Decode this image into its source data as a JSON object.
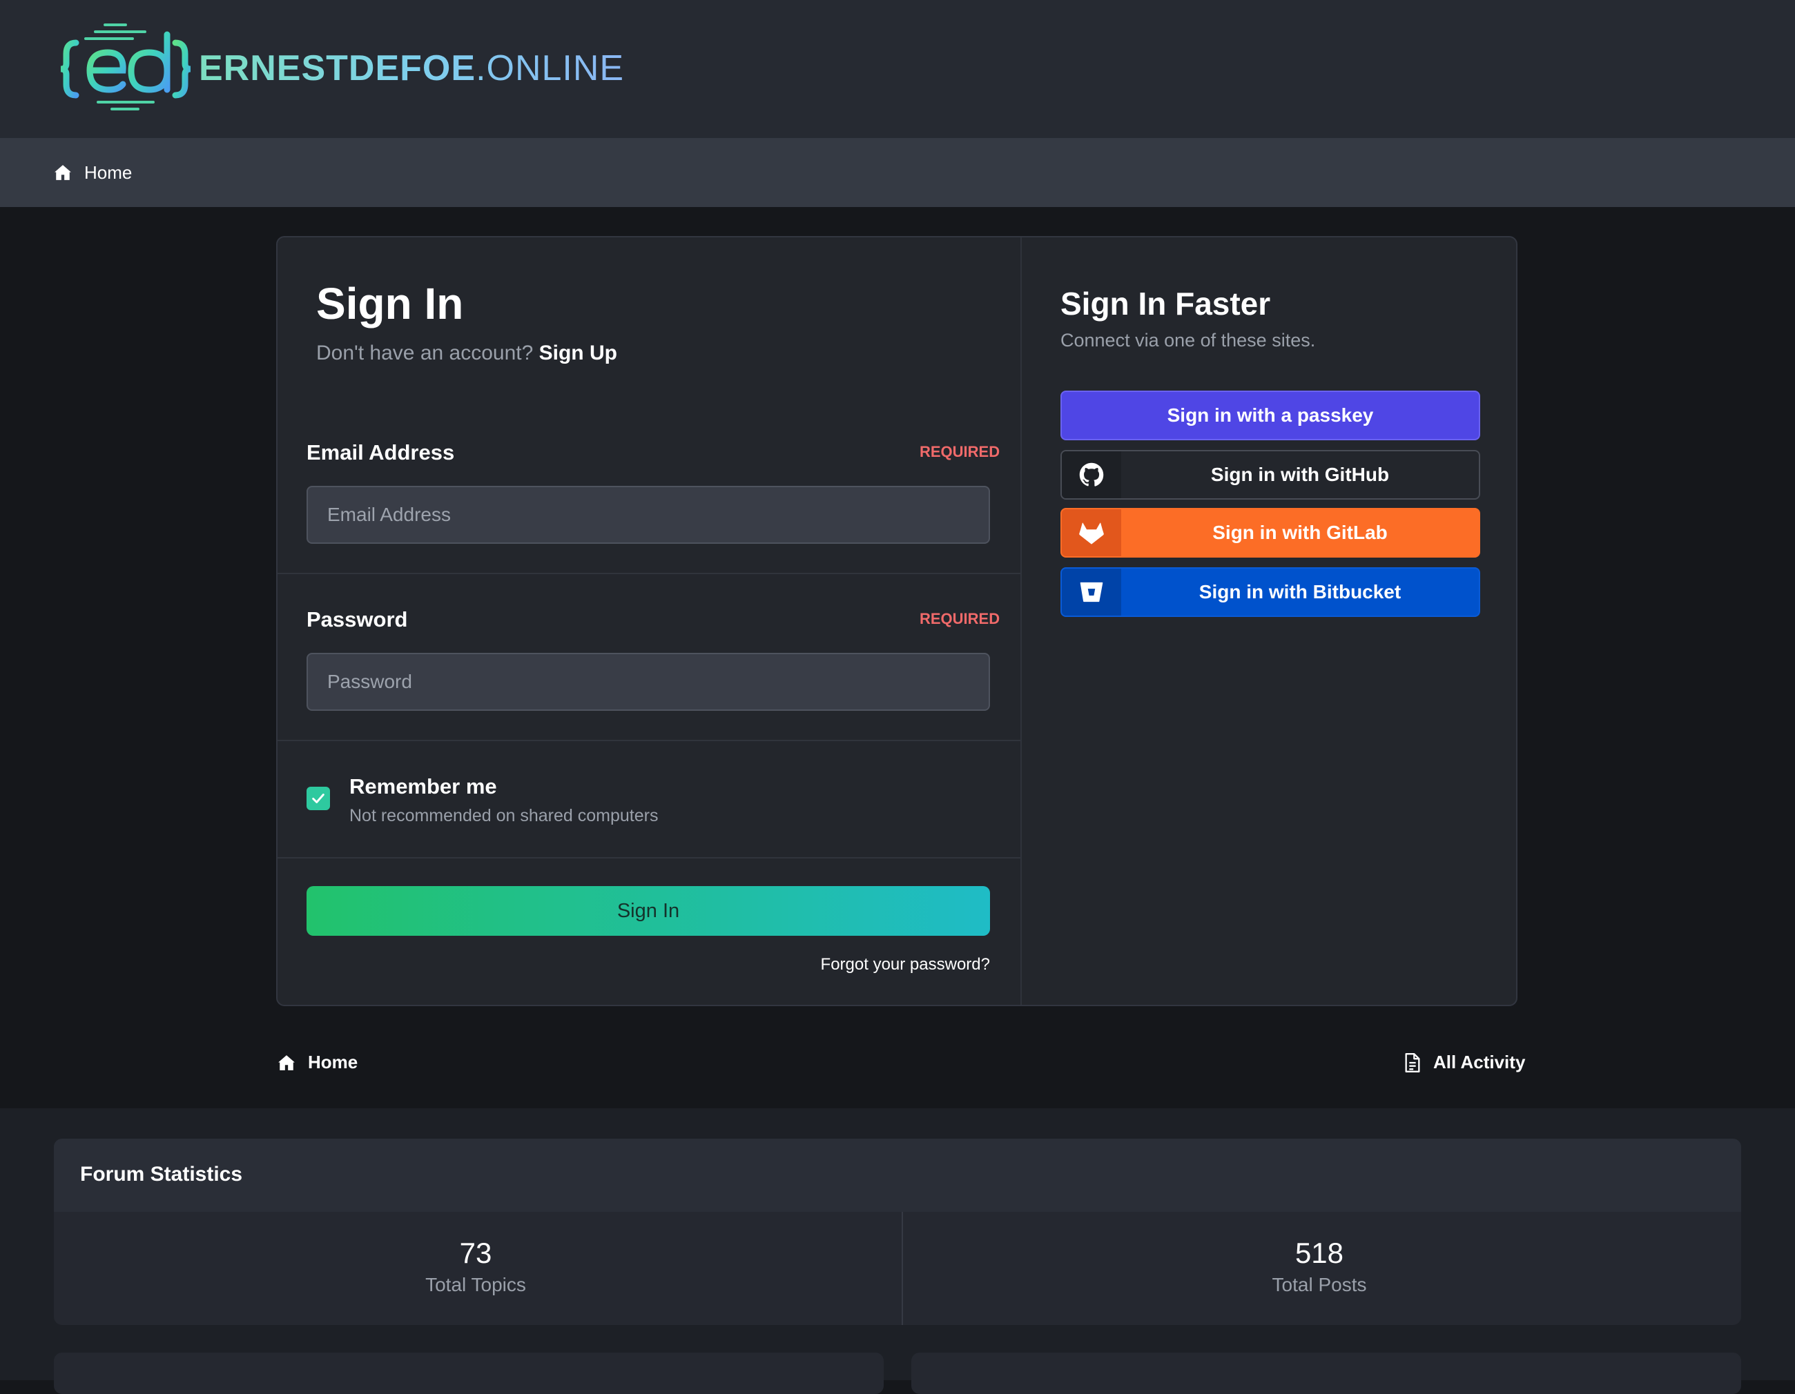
{
  "header": {
    "logo_icon": "ed-braces-logo-icon",
    "brand_main": "ERNESTDEFOE",
    "brand_tld": ".ONLINE"
  },
  "breadcrumb": {
    "home_label": "Home"
  },
  "signin": {
    "title": "Sign In",
    "no_account_text": "Don't have an account?",
    "signup_link": "Sign Up",
    "email_label": "Email Address",
    "email_required": "REQUIRED",
    "email_placeholder": "Email Address",
    "email_value": "",
    "password_label": "Password",
    "password_required": "REQUIRED",
    "password_placeholder": "Password",
    "password_value": "",
    "remember_label": "Remember me",
    "remember_hint": "Not recommended on shared computers",
    "remember_checked": true,
    "submit_label": "Sign In",
    "forgot_link": "Forgot your password?"
  },
  "faster": {
    "title": "Sign In Faster",
    "subtitle": "Connect via one of these sites.",
    "buttons": [
      {
        "label": "Sign in with a passkey",
        "color": "#4f46e5"
      },
      {
        "label": "Sign in with GitHub",
        "icon": "github-icon"
      },
      {
        "label": "Sign in with GitLab",
        "icon": "gitlab-icon",
        "color": "#fc6d26"
      },
      {
        "label": "Sign in with Bitbucket",
        "icon": "bitbucket-icon",
        "color": "#0052cc"
      }
    ]
  },
  "footer_nav": {
    "home_label": "Home",
    "activity_label": "All Activity"
  },
  "stats": {
    "title": "Forum Statistics",
    "items": [
      {
        "value": "73",
        "label": "Total Topics"
      },
      {
        "value": "518",
        "label": "Total Posts"
      }
    ]
  }
}
